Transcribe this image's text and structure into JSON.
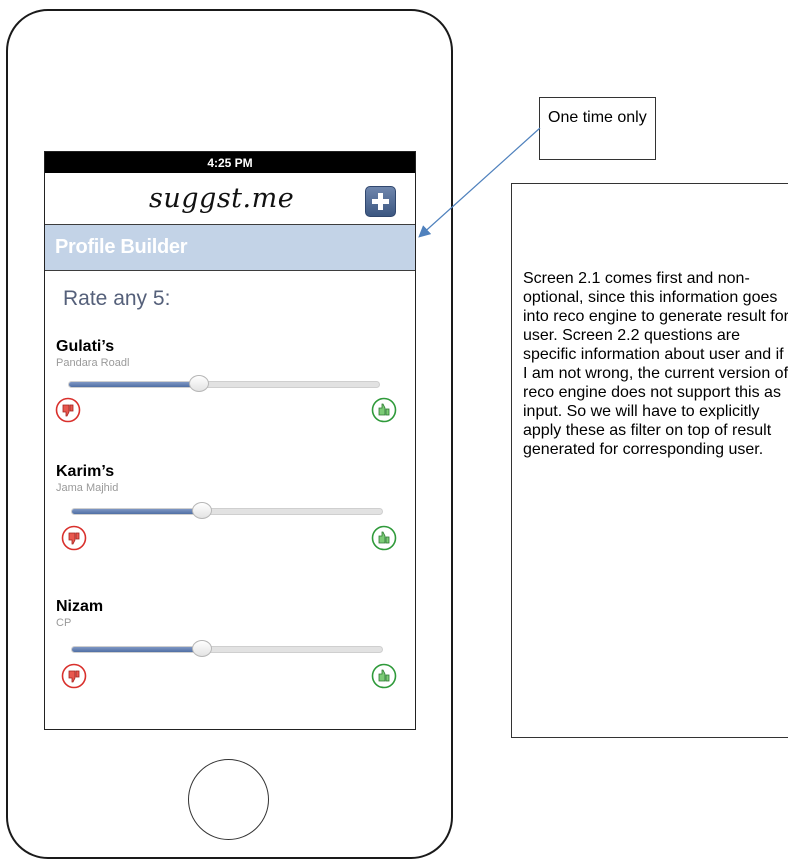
{
  "status_bar": {
    "time": "4:25 PM"
  },
  "header": {
    "logo": "suggst.me",
    "add_icon": "plus-icon"
  },
  "banner": {
    "title": "Profile Builder"
  },
  "section": {
    "title": "Rate any 5:"
  },
  "items": [
    {
      "name": "Gulati’s",
      "location": "Pandara Roadl",
      "rating_fraction": 0.42
    },
    {
      "name": "Karim’s",
      "location": "Jama Majhid",
      "rating_fraction": 0.42
    },
    {
      "name": "Nizam",
      "location": "CP",
      "rating_fraction": 0.42
    }
  ],
  "icons": {
    "dislike": "thumbs-down-icon",
    "like": "thumbs-up-icon"
  },
  "callout": {
    "text": "One time only"
  },
  "note": {
    "text": "Screen 2.1 comes first and non-optional, since this information goes into reco engine to generate result for user. Screen 2.2 questions are specific information about user and if I am not wrong, the current version of reco engine does not support this as input. So we will have to explicitly apply these as filter on top of result generated for corresponding user."
  },
  "colors": {
    "banner": "#c3d3e7",
    "slider_fill": "#506fa4",
    "add_button": "#3c5781",
    "dislike": "#d9302c",
    "like": "#2f9a3a",
    "arrow": "#4f81bd"
  }
}
